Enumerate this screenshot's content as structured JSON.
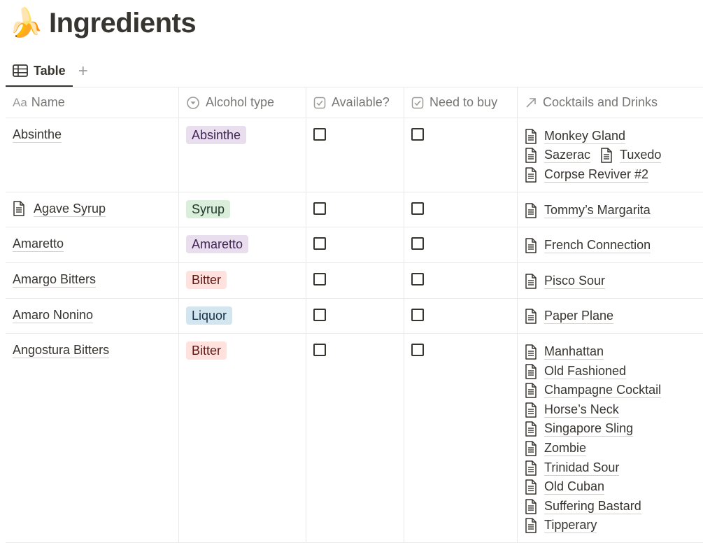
{
  "page": {
    "emoji": "🍌",
    "title": "Ingredients"
  },
  "tabs": {
    "active_label": "Table",
    "add_label": "+"
  },
  "columns": {
    "name": "Name",
    "name_icon": "Aa",
    "alcohol_type": "Alcohol type",
    "available": "Available?",
    "need_to_buy": "Need to buy",
    "cocktails": "Cocktails and Drinks"
  },
  "tag_colors": {
    "Absinthe": {
      "bg": "#e8deee",
      "fg": "#412454"
    },
    "Syrup": {
      "bg": "#dbeddb",
      "fg": "#1c3829"
    },
    "Amaretto": {
      "bg": "#e8deee",
      "fg": "#412454"
    },
    "Bitter": {
      "bg": "#ffe2dd",
      "fg": "#5d1715"
    },
    "Liquor": {
      "bg": "#d3e5ef",
      "fg": "#183347"
    }
  },
  "rows": [
    {
      "name": "Absinthe",
      "has_page_icon": false,
      "tag": "Absinthe",
      "available": false,
      "need_to_buy": false,
      "cocktails": [
        "Monkey Gland",
        "Sazerac",
        "Tuxedo",
        "Corpse Reviver #2"
      ]
    },
    {
      "name": "Agave Syrup",
      "has_page_icon": true,
      "tag": "Syrup",
      "available": false,
      "need_to_buy": false,
      "cocktails": [
        "Tommy’s Margarita"
      ]
    },
    {
      "name": "Amaretto",
      "has_page_icon": false,
      "tag": "Amaretto",
      "available": false,
      "need_to_buy": false,
      "cocktails": [
        "French Connection"
      ]
    },
    {
      "name": "Amargo Bitters",
      "has_page_icon": false,
      "tag": "Bitter",
      "available": false,
      "need_to_buy": false,
      "cocktails": [
        "Pisco Sour"
      ]
    },
    {
      "name": "Amaro Nonino",
      "has_page_icon": false,
      "tag": "Liquor",
      "available": false,
      "need_to_buy": false,
      "cocktails": [
        "Paper Plane"
      ]
    },
    {
      "name": "Angostura Bitters",
      "has_page_icon": false,
      "tag": "Bitter",
      "available": false,
      "need_to_buy": false,
      "cocktails": [
        "Manhattan",
        "Old Fashioned",
        "Champagne Cocktail",
        "Horse’s Neck",
        "Singapore Sling",
        "Zombie",
        "Trinidad Sour",
        "Old Cuban",
        "Suffering Bastard",
        "Tipperary"
      ]
    }
  ]
}
